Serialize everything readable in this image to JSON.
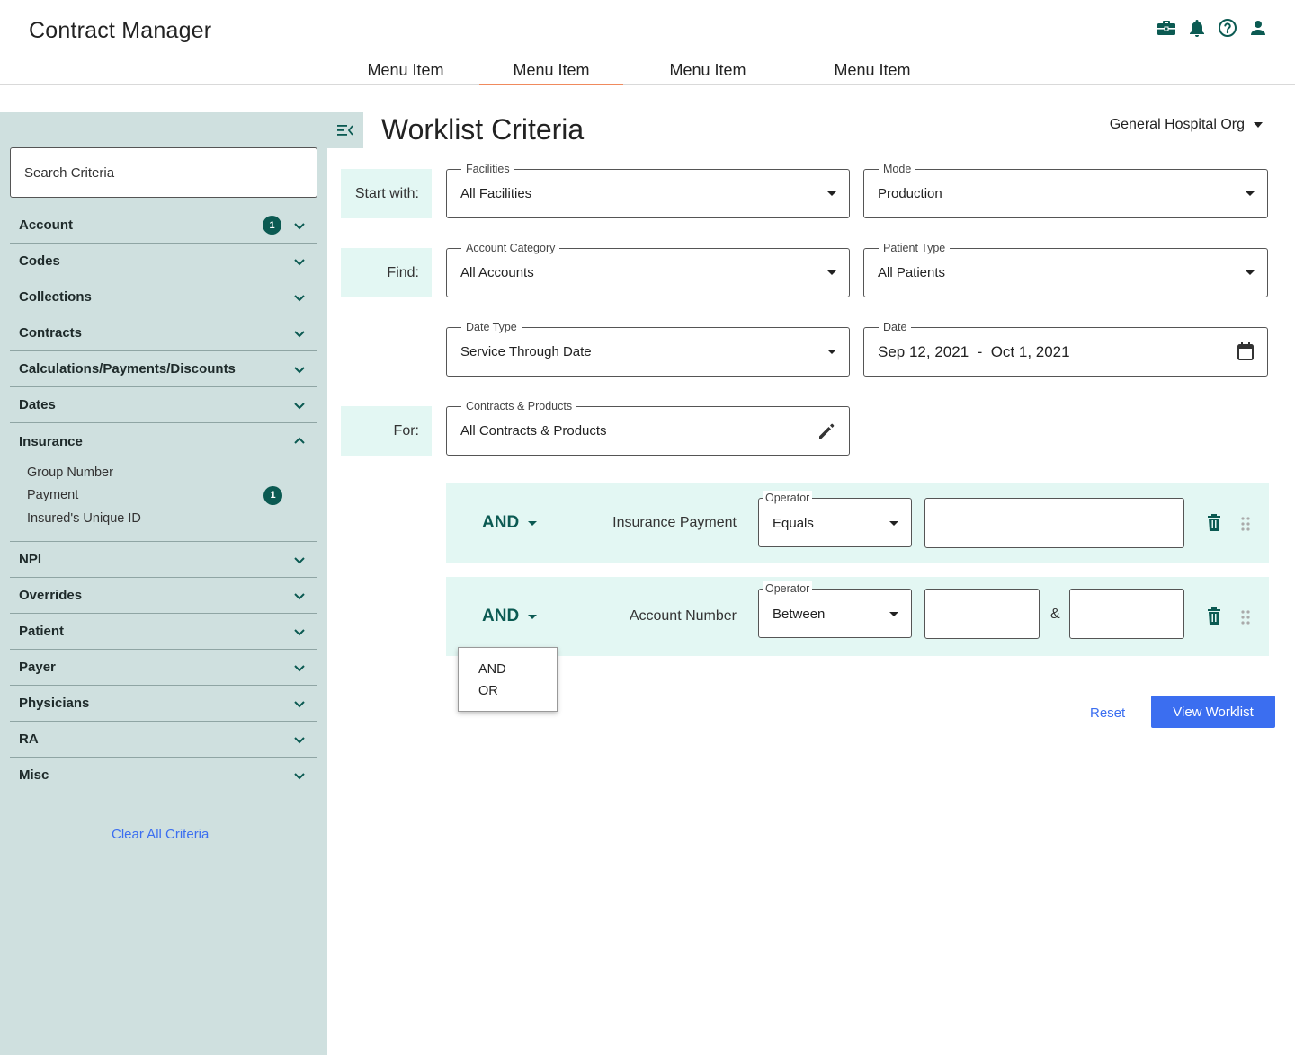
{
  "app": {
    "title": "Contract Manager"
  },
  "header_icons": [
    "briefcase-icon",
    "bell-icon",
    "help-icon",
    "user-icon"
  ],
  "nav": {
    "items": [
      {
        "label": "Menu Item",
        "active": false
      },
      {
        "label": "Menu Item",
        "active": true
      },
      {
        "label": "Menu Item",
        "active": false
      },
      {
        "label": "Menu Item",
        "active": false
      }
    ]
  },
  "sidebar": {
    "search_placeholder": "Search Criteria",
    "sections": [
      {
        "label": "Account",
        "badge": "1",
        "expanded": false
      },
      {
        "label": "Codes",
        "expanded": false
      },
      {
        "label": "Collections",
        "expanded": false
      },
      {
        "label": "Contracts",
        "expanded": false
      },
      {
        "label": "Calculations/Payments/Discounts",
        "expanded": false
      },
      {
        "label": "Dates",
        "expanded": false
      },
      {
        "label": "Insurance",
        "expanded": true,
        "items": [
          {
            "label": "Group Number"
          },
          {
            "label": "Payment",
            "badge": "1"
          },
          {
            "label": "Insured's Unique ID"
          }
        ]
      },
      {
        "label": "NPI",
        "expanded": false
      },
      {
        "label": "Overrides",
        "expanded": false
      },
      {
        "label": "Patient",
        "expanded": false
      },
      {
        "label": "Payer",
        "expanded": false
      },
      {
        "label": "Physicians",
        "expanded": false
      },
      {
        "label": "RA",
        "expanded": false
      },
      {
        "label": "Misc",
        "expanded": false
      }
    ],
    "clear_all": "Clear All Criteria"
  },
  "main": {
    "title": "Worklist Criteria",
    "org": "General Hospital Org",
    "rows": {
      "start_with": "Start with:",
      "find": "Find:",
      "for": "For:"
    },
    "fields": {
      "facilities": {
        "label": "Facilities",
        "value": "All Facilities"
      },
      "mode": {
        "label": "Mode",
        "value": "Production"
      },
      "account_category": {
        "label": "Account Category",
        "value": "All Accounts"
      },
      "patient_type": {
        "label": "Patient Type",
        "value": "All Patients"
      },
      "date_type": {
        "label": "Date Type",
        "value": "Service Through Date"
      },
      "date": {
        "label": "Date",
        "value": "Sep 12, 2021  -  Oct 1, 2021"
      },
      "contracts_products": {
        "label": "Contracts & Products",
        "value": "All Contracts & Products"
      }
    },
    "conditions": [
      {
        "logic": "AND",
        "name": "Insurance Payment",
        "operator_label": "Operator",
        "operator": "Equals"
      },
      {
        "logic": "AND",
        "name": "Account Number",
        "operator_label": "Operator",
        "operator": "Between",
        "separator": "&"
      }
    ],
    "logic_menu": [
      "AND",
      "OR"
    ],
    "reset": "Reset",
    "view_worklist": "View Worklist"
  },
  "colors": {
    "accent_teal": "#0b5a52",
    "sidebar_bg": "#cfe0df",
    "row_bg": "#e3f7f3",
    "primary_blue": "#3b6ef0",
    "nav_active": "#f08a5d"
  }
}
